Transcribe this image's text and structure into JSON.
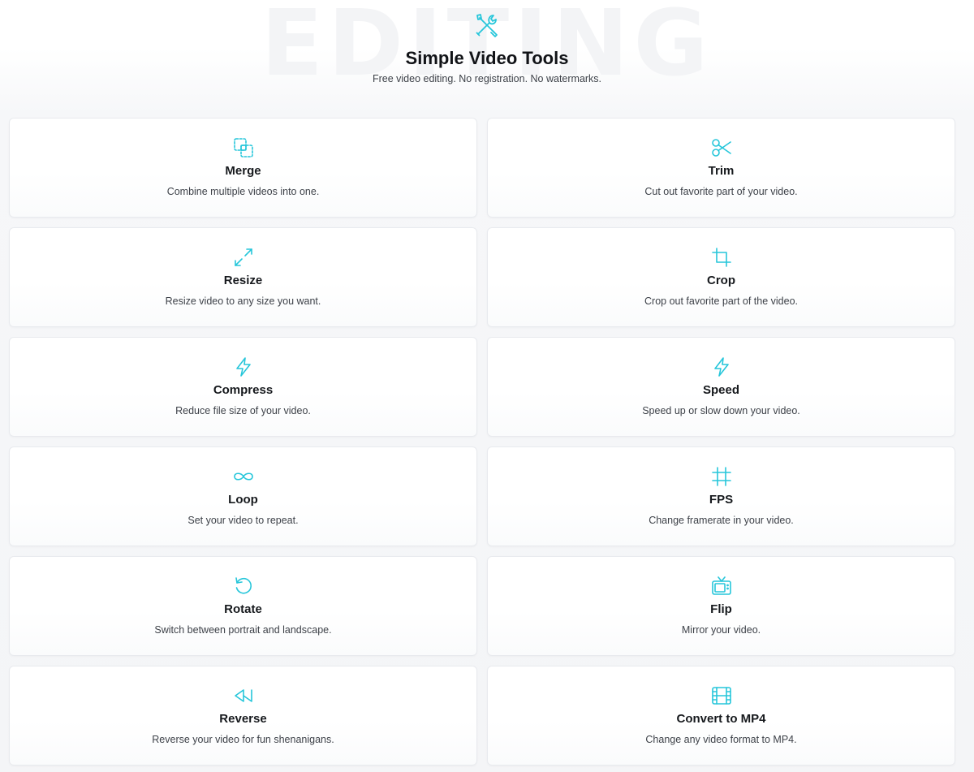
{
  "background_word": "EDITING",
  "header": {
    "icon": "tools-icon",
    "title": "Simple Video Tools",
    "subtitle": "Free video editing. No registration. No watermarks."
  },
  "accent_color": "#26c6da",
  "tools": [
    {
      "icon": "merge-icon",
      "title": "Merge",
      "desc": "Combine multiple videos into one."
    },
    {
      "icon": "scissors-icon",
      "title": "Trim",
      "desc": "Cut out favorite part of your video."
    },
    {
      "icon": "resize-icon",
      "title": "Resize",
      "desc": "Resize video to any size you want."
    },
    {
      "icon": "crop-icon",
      "title": "Crop",
      "desc": "Crop out favorite part of the video."
    },
    {
      "icon": "lightning-icon",
      "title": "Compress",
      "desc": "Reduce file size of your video."
    },
    {
      "icon": "lightning-icon",
      "title": "Speed",
      "desc": "Speed up or slow down your video."
    },
    {
      "icon": "infinity-icon",
      "title": "Loop",
      "desc": "Set your video to repeat."
    },
    {
      "icon": "frame-icon",
      "title": "FPS",
      "desc": "Change framerate in your video."
    },
    {
      "icon": "rotate-icon",
      "title": "Rotate",
      "desc": "Switch between portrait and landscape."
    },
    {
      "icon": "tv-icon",
      "title": "Flip",
      "desc": "Mirror your video."
    },
    {
      "icon": "rewind-icon",
      "title": "Reverse",
      "desc": "Reverse your video for fun shenanigans."
    },
    {
      "icon": "film-icon",
      "title": "Convert to MP4",
      "desc": "Change any video format to MP4."
    }
  ]
}
